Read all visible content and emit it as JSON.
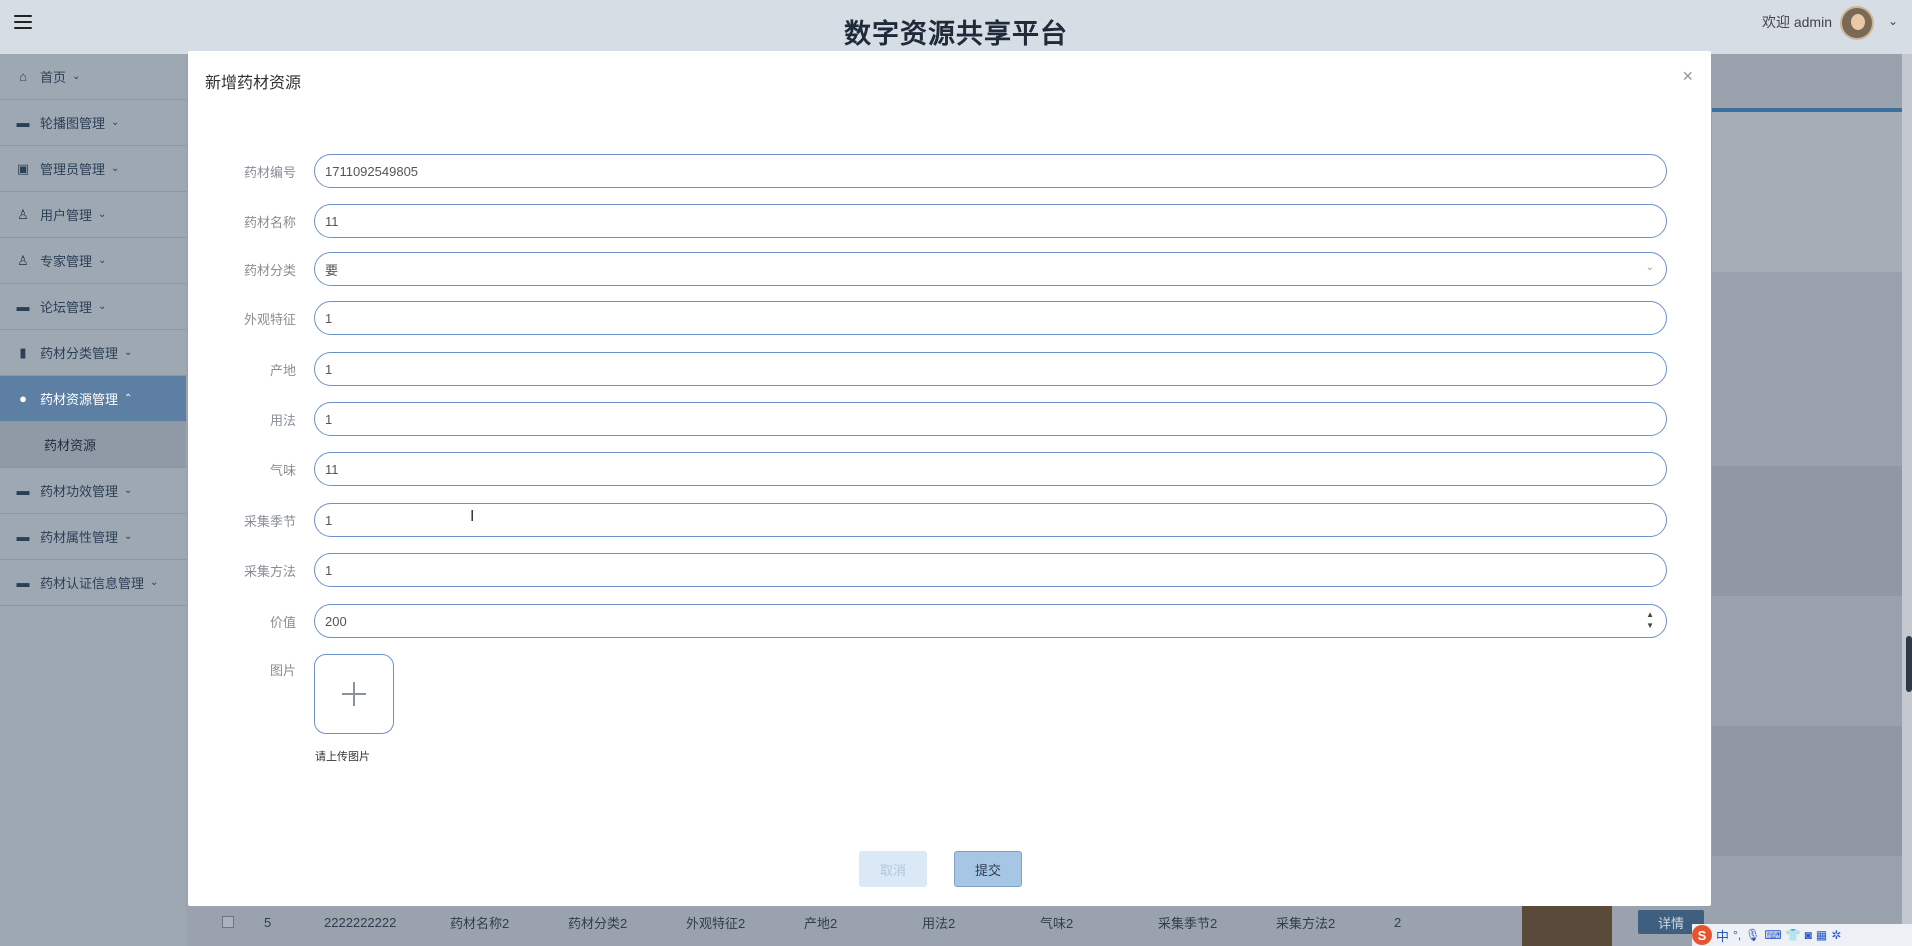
{
  "header": {
    "site_title": "数字资源共享平台",
    "welcome": "欢迎 admin"
  },
  "sidebar": {
    "items": [
      {
        "label": "首页",
        "icon": "home-icon"
      },
      {
        "label": "轮播图管理",
        "icon": "image-icon"
      },
      {
        "label": "管理员管理",
        "icon": "briefcase-icon"
      },
      {
        "label": "用户管理",
        "icon": "user-icon"
      },
      {
        "label": "专家管理",
        "icon": "user-icon"
      },
      {
        "label": "论坛管理",
        "icon": "folder-icon"
      },
      {
        "label": "药材分类管理",
        "icon": "book-icon"
      },
      {
        "label": "药材资源管理",
        "icon": "drop-icon"
      },
      {
        "label": "药材功效管理",
        "icon": "box-icon"
      },
      {
        "label": "药材属性管理",
        "icon": "archive-icon"
      },
      {
        "label": "药材认证信息管理",
        "icon": "card-icon"
      }
    ],
    "active_sub": "药材资源"
  },
  "table_row": {
    "cells": [
      "5",
      "2222222222",
      "药材名称2",
      "药材分类2",
      "外观特征2",
      "产地2",
      "用法2",
      "气味2",
      "采集季节2",
      "采集方法2",
      "2"
    ],
    "detail_button": "详情"
  },
  "ime": {
    "logo": "S",
    "mode": "中"
  },
  "modal": {
    "title": "新增药材资源",
    "close": "×",
    "fields": [
      {
        "label": "药材编号",
        "value": "1711092549805"
      },
      {
        "label": "药材名称",
        "value": "11"
      },
      {
        "label": "药材分类",
        "value": "要"
      },
      {
        "label": "外观特征",
        "value": "1"
      },
      {
        "label": "产地",
        "value": "1"
      },
      {
        "label": "用法",
        "value": "1"
      },
      {
        "label": "气味",
        "value": "11"
      },
      {
        "label": "采集季节",
        "value": "1"
      },
      {
        "label": "采集方法",
        "value": "1"
      },
      {
        "label": "价值",
        "value": "200"
      }
    ],
    "image_label": "图片",
    "upload_tip": "请上传图片",
    "cancel_label": "取消",
    "submit_label": "提交"
  }
}
